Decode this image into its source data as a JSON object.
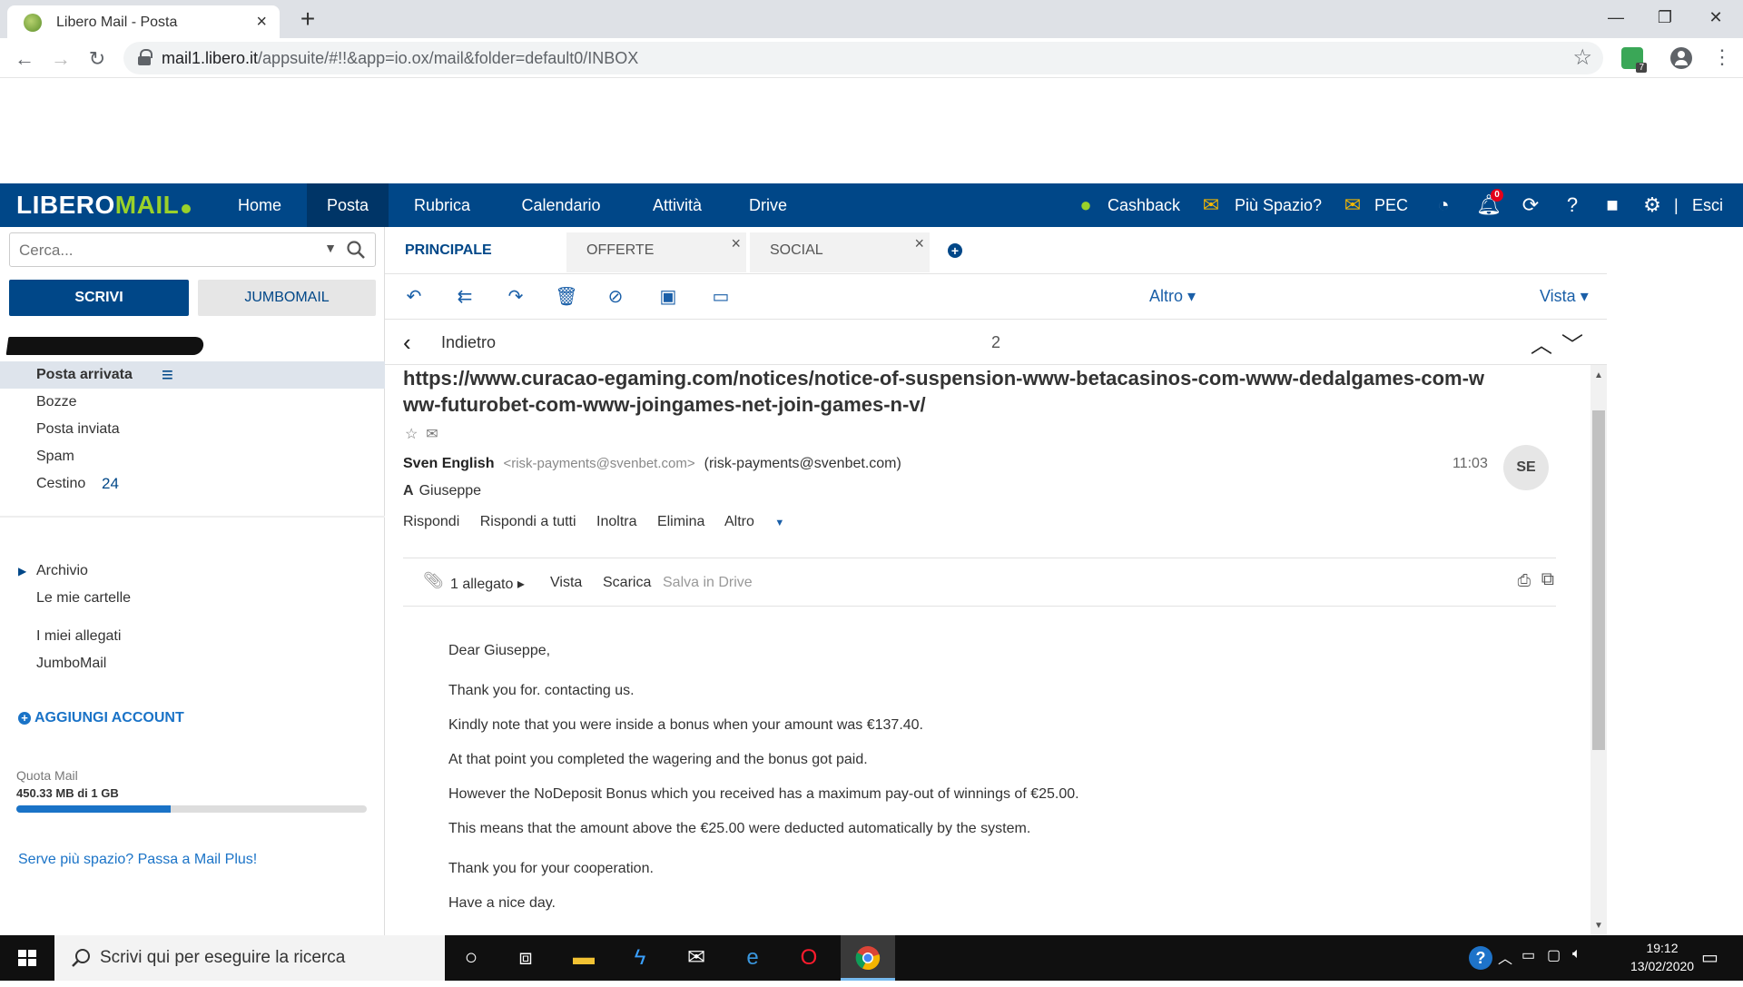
{
  "browser": {
    "tab_title": "Libero Mail - Posta",
    "tab_close": "×",
    "new_tab": "+",
    "window_controls": [
      "—",
      "❐",
      "✕"
    ],
    "url_host": "mail1.libero.it",
    "url_path": "/appsuite/#!!&app=io.ox/mail&folder=default0/INBOX",
    "extension_badge": "7"
  },
  "header": {
    "logo_a": "LIBERO",
    "logo_b": "MAIL",
    "nav": [
      "Home",
      "Posta",
      "Rubrica",
      "Calendario",
      "Attività",
      "Drive"
    ],
    "active_nav": "Posta",
    "cashback": "Cashback",
    "more_space": "Più Spazio?",
    "pec": "PEC",
    "notifications_count": "0",
    "logout": "Esci",
    "separator": "|"
  },
  "sidebar": {
    "search_placeholder": "Cerca...",
    "compose_label": "SCRIVI",
    "jumbomail_label": "JUMBOMAIL",
    "folders": [
      {
        "label": "Posta arrivata"
      },
      {
        "label": "Bozze"
      },
      {
        "label": "Posta inviata"
      },
      {
        "label": "Spam"
      },
      {
        "label": "Cestino",
        "count": "24"
      }
    ],
    "section2": [
      {
        "label": "Archivio"
      },
      {
        "label": "Le mie cartelle"
      }
    ],
    "section3": [
      {
        "label": "I miei allegati"
      },
      {
        "label": "JumboMail"
      }
    ],
    "add_account": "AGGIUNGI ACCOUNT",
    "quota_label": "Quota Mail",
    "quota_value": "450.33 MB di 1 GB",
    "quota_fraction": 0.44,
    "more_space_link": "Serve più spazio? Passa a Mail Plus!"
  },
  "mailtabs": [
    {
      "label": "PRINCIPALE"
    },
    {
      "label": "OFFERTE",
      "close": "×"
    },
    {
      "label": "SOCIAL",
      "close": "×"
    }
  ],
  "toolbar": {
    "altro": "Altro",
    "vista": "Vista"
  },
  "nav": {
    "back": "Indietro",
    "count": "2"
  },
  "message": {
    "subject": "https://www.curacao-egaming.com/notices/notice-of-suspension-www-betacasinos-com-www-dedalgames-com-www-futurobet-com-www-joingames-net-join-games-n-v/",
    "sender_name": "Sven English",
    "sender_email": "<risk-payments@svenbet.com>",
    "sender_alias": "(risk-payments@svenbet.com)",
    "time": "11:03",
    "avatar": "SE",
    "to_label": "A",
    "to_name": "Giuseppe",
    "actions": [
      "Rispondi",
      "Rispondi a tutti",
      "Inoltra",
      "Elimina",
      "Altro"
    ],
    "attachments": "1 allegato",
    "attach_actions": [
      "Vista",
      "Scarica",
      "Salva in Drive"
    ],
    "body": [
      "Dear Giuseppe,",
      "Thank you for. contacting us.",
      "Kindly note that you were inside a bonus when your amount was €137.40.",
      "At that point you completed the wagering and the bonus got paid.",
      "However the NoDeposit Bonus which you received has a maximum pay-out of winnings of €25.00.",
      "This means that the amount above the €25.00 were deducted automatically by the system.",
      "Thank you for your cooperation.",
      "Have a nice day."
    ]
  },
  "taskbar": {
    "search_label": "Scrivi qui per eseguire la ricerca",
    "time": "19:12",
    "date": "13/02/2020"
  },
  "colors": {
    "brand_blue": "#004788",
    "accent_green": "#9ad12a",
    "link_blue": "#1a73c7"
  }
}
